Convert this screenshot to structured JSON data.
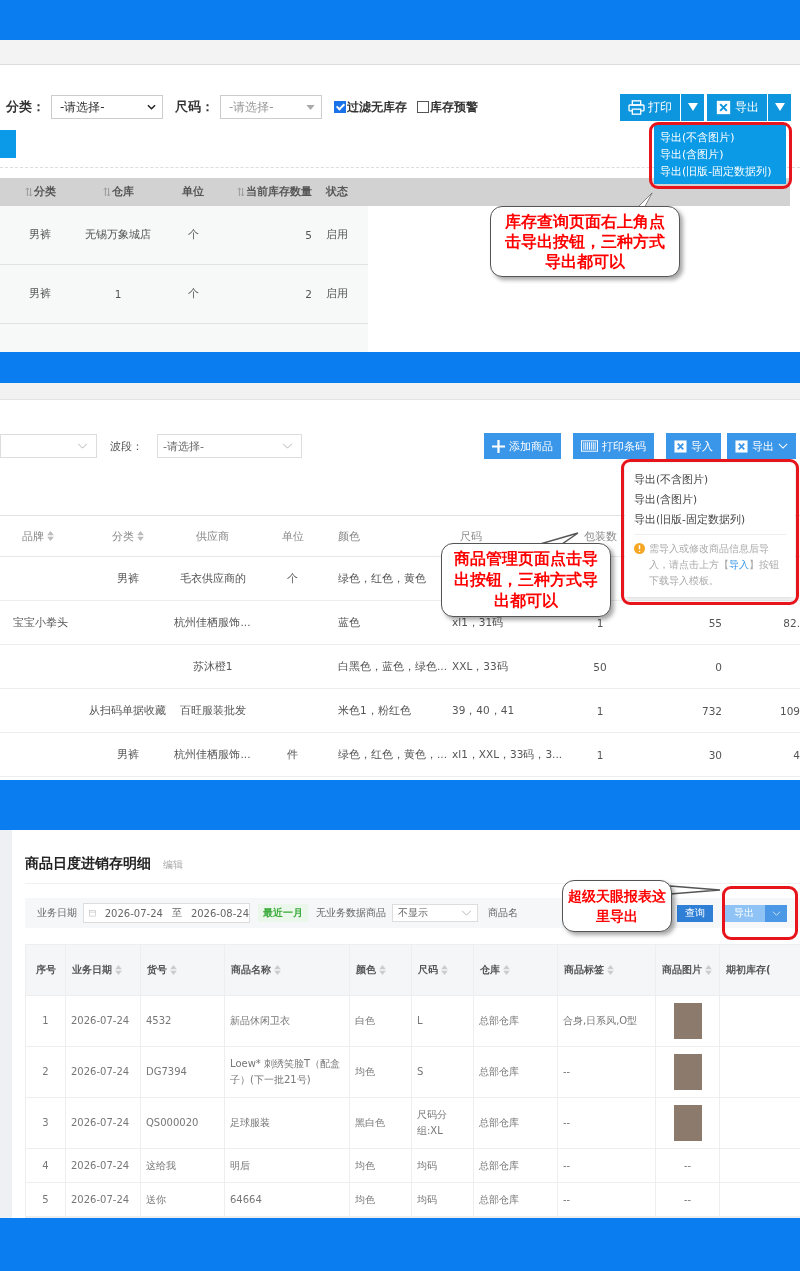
{
  "panel_1": {
    "filters": [
      {
        "label": "分类：",
        "value": "-请选择-"
      },
      {
        "label": "尺码：",
        "placeholder": "-请选择-"
      }
    ],
    "checkboxes": [
      {
        "label": "过滤无库存",
        "checked": true
      },
      {
        "label": "库存预警",
        "checked": false
      }
    ],
    "buttons": [
      {
        "label": "打印",
        "kind": "print"
      },
      {
        "label": "导出",
        "kind": "export"
      }
    ],
    "export_menu": [
      "导出(不含图片)",
      "导出(含图片)",
      "导出(旧版-固定数据列)"
    ],
    "callout": "库存查询页面右上角点击导出按钮，三种方式导出都可以",
    "table": {
      "columns": [
        {
          "label": "分类",
          "sortable": true
        },
        {
          "label": "仓库",
          "sortable": true
        },
        {
          "label": "单位",
          "sortable": false
        },
        {
          "label": "当前库存数量",
          "sortable": true
        },
        {
          "label": "状态",
          "sortable": false
        }
      ],
      "rows": [
        [
          "男裤",
          "无锡万象城店",
          "个",
          "5",
          "启用"
        ],
        [
          "男裤",
          "1",
          "个",
          "2",
          "启用"
        ]
      ]
    }
  },
  "panel_2": {
    "filters": [
      {
        "label": "波段：",
        "placeholder": "-请选择-"
      }
    ],
    "buttons": [
      {
        "label": "添加商品",
        "kind": "add"
      },
      {
        "label": "打印条码",
        "kind": "barcode"
      },
      {
        "label": "导入",
        "kind": "import"
      },
      {
        "label": "导出",
        "kind": "export"
      }
    ],
    "export_menu": {
      "items": [
        "导出(不含图片)",
        "导出(含图片)",
        "导出(旧版-固定数据列)"
      ],
      "notice": {
        "before": "需导入或修改商品信息后导入，请点击上方【",
        "link": "导入",
        "after": "】按钮下载导入模板。"
      }
    },
    "callout": "商品管理页面点击导出按钮，三种方式导出都可以",
    "table": {
      "columns": [
        {
          "label": "品牌",
          "sortable": true
        },
        {
          "label": "分类",
          "sortable": true
        },
        {
          "label": "供应商",
          "sortable": false
        },
        {
          "label": "单位",
          "sortable": false
        },
        {
          "label": "颜色",
          "sortable": false
        },
        {
          "label": "尺码",
          "sortable": false
        },
        {
          "label": "包装数",
          "sortable": false
        }
      ],
      "rows": [
        {
          "column_2": "男裤",
          "column_3": "毛衣供应商的",
          "column_4": "个",
          "column_5": "绿色，红色，黄色"
        },
        {
          "column_1": "宝宝小拳头",
          "column_3": "杭州佳栖服饰...",
          "column_5": "蓝色",
          "column_6": "xl1，31码",
          "column_7": "1",
          "column_8": "55",
          "column_9": "82."
        },
        {
          "column_3": "苏沐橙1",
          "column_5": "白黑色，蓝色，绿色...",
          "column_6": "XXL，33码",
          "column_7": "50",
          "column_8": "0"
        },
        {
          "column_2": "从扫码单据收藏",
          "column_3": "百旺服装批发",
          "column_5": "米色1，粉红色",
          "column_6": "39，40，41",
          "column_7": "1",
          "column_8": "732",
          "column_9": "109"
        },
        {
          "column_2": "男裤",
          "column_3": "杭州佳栖服饰...",
          "column_4": "件",
          "column_5": "绿色，红色，黄色，...",
          "column_6": "xl1，XXL，33码，3...",
          "column_7": "1",
          "column_8": "30",
          "column_9": "4"
        }
      ]
    }
  },
  "panel_3": {
    "title": "商品日度进销存明细",
    "title_action": "编辑",
    "filters": {
      "date_label": "业务日期",
      "start": "2026-07-24",
      "separator": "至",
      "end": "2026-08-24",
      "quick_range": "最近一月",
      "empty_label": "无业务数据商品",
      "empty_value": "不显示",
      "name_label": "商品名"
    },
    "buttons": [
      {
        "label": "查询",
        "kind": "query"
      },
      {
        "label": "导出",
        "kind": "export"
      }
    ],
    "callout": "超级天眼报表这里导出",
    "table": {
      "columns": [
        {
          "label": "序号",
          "sortable": false
        },
        {
          "label": "业务日期",
          "sortable": true
        },
        {
          "label": "货号",
          "sortable": true
        },
        {
          "label": "商品名称",
          "sortable": true
        },
        {
          "label": "颜色",
          "sortable": true
        },
        {
          "label": "尺码",
          "sortable": true
        },
        {
          "label": "仓库",
          "sortable": true
        },
        {
          "label": "商品标签",
          "sortable": true
        },
        {
          "label": "商品图片",
          "sortable": true
        },
        {
          "label": "期初库存(",
          "sortable": false
        }
      ],
      "rows": [
        {
          "cells": [
            "1",
            "2026-07-24",
            "4532",
            "新品休闲卫衣",
            "白色",
            "L",
            "总部仓库",
            "合身,日系风,O型"
          ],
          "image": {
            "kind": "photo"
          }
        },
        {
          "cells": [
            "2",
            "2026-07-24",
            "DG7394",
            "Loew* 刺绣笑脸T（配盒子）(下一批21号)",
            "均色",
            "S",
            "总部仓库",
            "--"
          ],
          "image": {
            "kind": "photo"
          }
        },
        {
          "cells": [
            "3",
            "2026-07-24",
            "QS000020",
            "足球服装",
            "黑白色",
            "尺码分组:XL",
            "总部仓库",
            "--"
          ],
          "image": {
            "kind": "photo"
          }
        },
        {
          "cells": [
            "4",
            "2026-07-24",
            "这给我",
            "明后",
            "均色",
            "均码",
            "总部仓库",
            "--"
          ],
          "image": {
            "kind": "text",
            "text": "--"
          }
        },
        {
          "cells": [
            "5",
            "2026-07-24",
            "送你",
            "64664",
            "均色",
            "均码",
            "总部仓库",
            "--"
          ],
          "image": {
            "kind": "text",
            "text": "--"
          }
        }
      ]
    }
  }
}
